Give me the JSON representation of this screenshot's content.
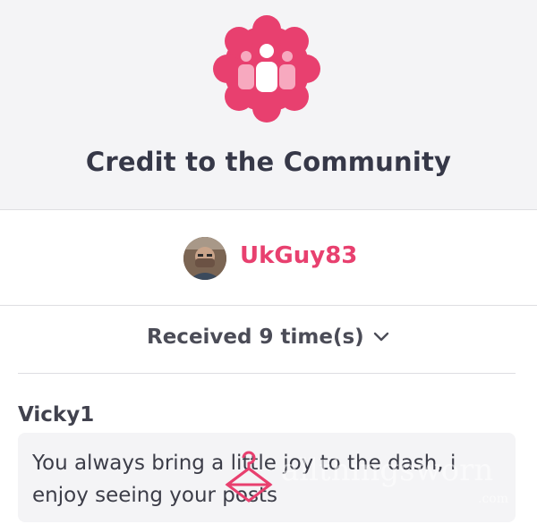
{
  "header": {
    "title": "Credit to the Community",
    "badge_icon": "community-people-icon",
    "badge_color": "#e8406f"
  },
  "user": {
    "username": "UkGuy83",
    "avatar": "user-avatar",
    "name_color": "#e8406f"
  },
  "received": {
    "label": "Received 9 time(s)",
    "icon": "chevron-down-icon"
  },
  "comment": {
    "author": "Vicky1",
    "text": "You always bring a little joy to the dash, i enjoy seeing your posts"
  },
  "watermark": {
    "text": "allthingsworn",
    "suffix": ".com"
  }
}
